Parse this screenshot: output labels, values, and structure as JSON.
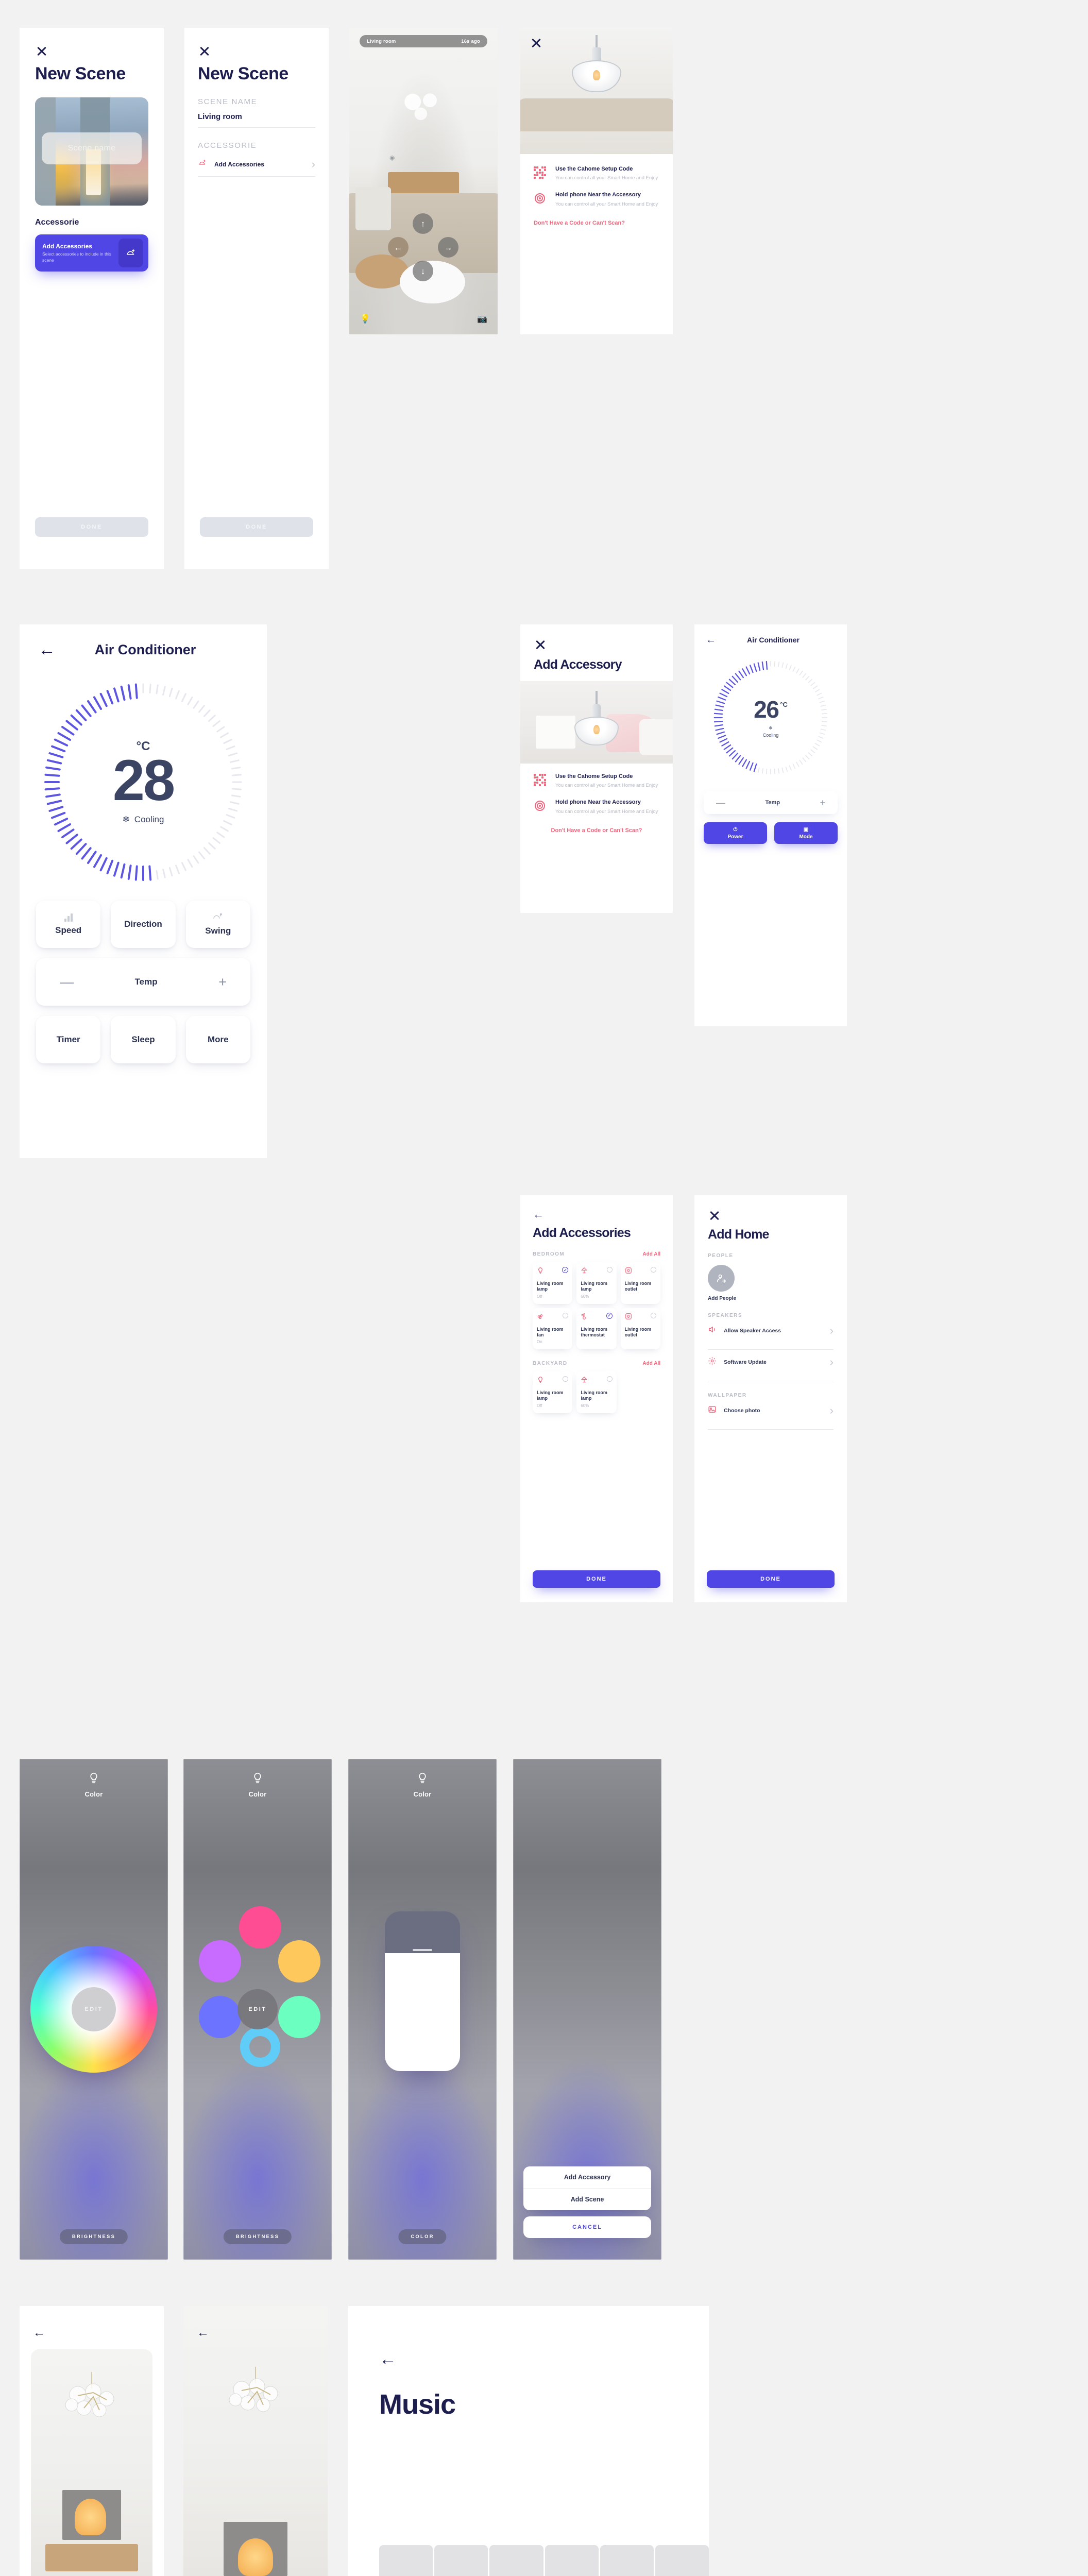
{
  "new_scene_picker": {
    "close_icon": "close-icon",
    "title": "New Scene",
    "scene_name_placeholder": "Scene name",
    "section_label": "Accessorie",
    "add_card": {
      "title": "Add Accessories",
      "subtitle": "Select accessories to include in this scene",
      "icon": "add-accessory-icon"
    },
    "done_label": "DONE"
  },
  "new_scene_form": {
    "close_icon": "close-icon",
    "title": "New Scene",
    "scene_name_label": "SCENE NAME",
    "scene_name_value": "Living room",
    "accessorie_label": "ACCESSORIE",
    "add_accessories_label": "Add Accessories",
    "done_label": "DONE"
  },
  "ar_view": {
    "room_label": "Living room",
    "time_label": "16s ago",
    "up_icon": "arrow-up-icon",
    "down_icon": "arrow-down-icon",
    "left_icon": "arrow-left-icon",
    "right_icon": "arrow-right-icon",
    "bulb_icon": "bulb-icon",
    "camera_icon": "camera-icon"
  },
  "setup_photo": {
    "close_icon": "close-icon",
    "items": [
      {
        "icon": "qr-code-icon",
        "title": "Use the Cahome Setup Code",
        "desc": "You can control all your Smart Home and Enjoy"
      },
      {
        "icon": "nfc-icon",
        "title": "Hold phone Near the Accessory",
        "desc": "You can control all your Smart Home and Enjoy"
      }
    ],
    "link": "Don't Have a Code or Can't Scan?"
  },
  "add_accessory": {
    "close_icon": "close-icon",
    "title": "Add Accessory",
    "items": [
      {
        "icon": "qr-code-icon",
        "title": "Use the Cahome Setup Code",
        "desc": "You can control all your Smart Home and Enjoy"
      },
      {
        "icon": "nfc-icon",
        "title": "Hold phone Near the Accessory",
        "desc": "You can control all your Smart Home and Enjoy"
      }
    ],
    "link": "Don't Have a Code or Can't Scan?"
  },
  "ac_big": {
    "back_icon": "back-arrow-icon",
    "title": "Air Conditioner",
    "unit": "°C",
    "temperature": "28",
    "mode_icon": "snowflake-icon",
    "mode": "Cooling",
    "tiles": [
      {
        "label": "Speed",
        "icon": "signal-bars-icon"
      },
      {
        "label": "Direction",
        "icon": "direction-icon"
      },
      {
        "label": "Swing",
        "icon": "swing-icon"
      }
    ],
    "temp_row": {
      "minus": "—",
      "label": "Temp",
      "plus": "+"
    },
    "tiles2": [
      {
        "label": "Timer",
        "icon": ""
      },
      {
        "label": "Sleep",
        "icon": ""
      },
      {
        "label": "More",
        "icon": ""
      }
    ]
  },
  "ac_small": {
    "back_icon": "back-arrow-icon",
    "title": "Air Conditioner",
    "temperature": "26",
    "unit": "°C",
    "mode_icon": "snowflake-icon",
    "mode": "Cooling",
    "temp_row": {
      "minus": "—",
      "label": "Temp",
      "plus": "+"
    },
    "buttons": [
      {
        "label": "Power",
        "icon": "power-icon"
      },
      {
        "label": "Mode",
        "icon": "mode-icon"
      }
    ]
  },
  "add_accessories": {
    "back_icon": "back-arrow-icon",
    "title": "Add Accessories",
    "add_all_label": "Add All",
    "groups": [
      {
        "name": "BEDROOM",
        "items": [
          {
            "icon": "bulb-icon",
            "name": "Living room lamp",
            "status": "Off",
            "selected": true
          },
          {
            "icon": "lamp-icon",
            "name": "Living room lamp",
            "status": "60%",
            "selected": false
          },
          {
            "icon": "outlet-icon",
            "name": "Living room outlet",
            "status": "",
            "selected": false
          },
          {
            "icon": "fan-icon",
            "name": "Living room fan",
            "status": "On",
            "selected": false
          },
          {
            "icon": "thermostat-icon",
            "name": "Living room thermostat",
            "status": "",
            "selected": true
          },
          {
            "icon": "outlet-icon",
            "name": "Living room outlet",
            "status": "",
            "selected": false
          }
        ]
      },
      {
        "name": "BACKYARD",
        "items": [
          {
            "icon": "bulb-icon",
            "name": "Living room lamp",
            "status": "Off",
            "selected": false
          },
          {
            "icon": "lamp-icon",
            "name": "Living room lamp",
            "status": "60%",
            "selected": false
          }
        ]
      }
    ],
    "done_label": "DONE"
  },
  "add_home": {
    "close_icon": "close-icon",
    "title": "Add Home",
    "people_label": "PEOPLE",
    "add_people_label": "Add People",
    "add_people_icon": "add-person-icon",
    "speakers_label": "SPEAKERS",
    "rows": [
      {
        "icon": "speaker-icon",
        "label": "Allow Speaker Access"
      },
      {
        "icon": "gear-icon",
        "label": "Software Update"
      }
    ],
    "wallpaper_label": "WALLPAPER",
    "wallpaper_row": {
      "icon": "photo-icon",
      "label": "Choose photo"
    },
    "done_label": "DONE"
  },
  "light_wheel": {
    "bulb_icon": "bulb-icon",
    "header": "Color",
    "edit_label": "EDIT",
    "pill_label": "BRIGHTNESS"
  },
  "light_swatches": {
    "bulb_icon": "bulb-icon",
    "header": "Color",
    "edit_label": "EDIT",
    "pill_label": "BRIGHTNESS",
    "swatches": [
      {
        "name": "pink",
        "hex": "#FF4D94"
      },
      {
        "name": "orange",
        "hex": "#FFC85C"
      },
      {
        "name": "violet",
        "hex": "#C86BFF"
      },
      {
        "name": "mint",
        "hex": "#6BFFC0"
      },
      {
        "name": "blue",
        "hex": "#6B73FF"
      },
      {
        "name": "cyan-ring",
        "hex": "#5FCDF7"
      }
    ]
  },
  "light_slider": {
    "bulb_icon": "bulb-icon",
    "header": "Color",
    "pill_label": "COLOR"
  },
  "light_sheet": {
    "options": [
      "Add Accessory",
      "Add Scene"
    ],
    "cancel_label": "CANCEL"
  },
  "detail_1": {
    "back_icon": "back-arrow-icon"
  },
  "detail_2": {
    "back_icon": "back-arrow-icon"
  },
  "music": {
    "back_icon": "back-arrow-icon",
    "title": "Music"
  },
  "colors": {
    "accent": "#4F46E5",
    "pink": "#F1647C",
    "navy": "#1D1E4E",
    "slate": "#3B4463",
    "muted": "#B9BCC6",
    "page_bg": "#F2F2F3"
  }
}
